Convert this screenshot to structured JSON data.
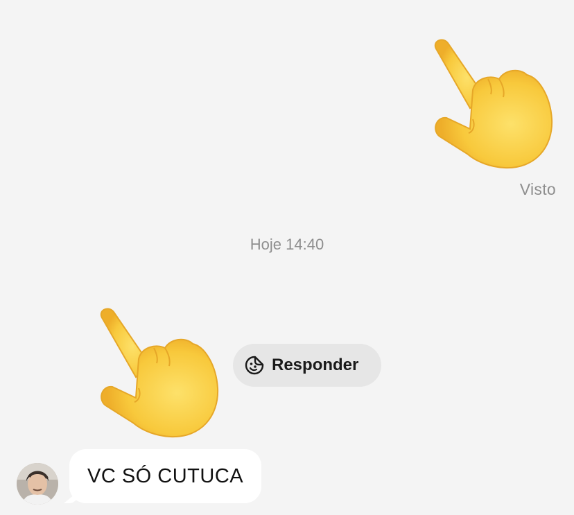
{
  "thread": {
    "sent_message": {
      "content": "emoji",
      "icon": "backhand-index-pointing-down-emoji"
    },
    "seen_label": "Visto",
    "timestamp": "Hoje 14:40",
    "received_emoji": {
      "content": "emoji",
      "icon": "backhand-index-pointing-down-emoji"
    },
    "reply_button": {
      "icon": "sticker-smiley-icon",
      "label": "Responder"
    },
    "received_message": {
      "text": "VC SÓ CUTUCA",
      "avatar": "contact-avatar"
    }
  },
  "colors": {
    "background": "#f4f4f4",
    "bubble": "#ffffff",
    "pill": "#e6e6e6",
    "meta_text": "#8e8e8e",
    "emoji_yellow": "#fbd24f"
  }
}
